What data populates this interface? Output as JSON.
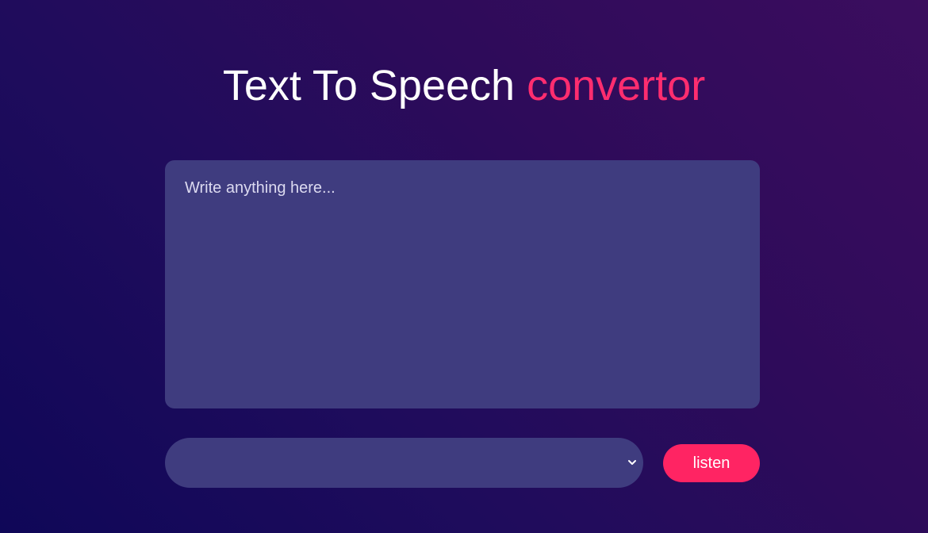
{
  "header": {
    "title_main": "Text To Speech",
    "title_accent": "convertor"
  },
  "editor": {
    "placeholder": "Write anything here...",
    "value": ""
  },
  "voice_select": {
    "selected": "",
    "icon": "chevron-down-icon"
  },
  "actions": {
    "listen_label": "listen"
  },
  "colors": {
    "accent": "#ff2463",
    "panel": "#3f3c7f",
    "background_start": "#0f0758",
    "background_end": "#3b0d5e"
  }
}
